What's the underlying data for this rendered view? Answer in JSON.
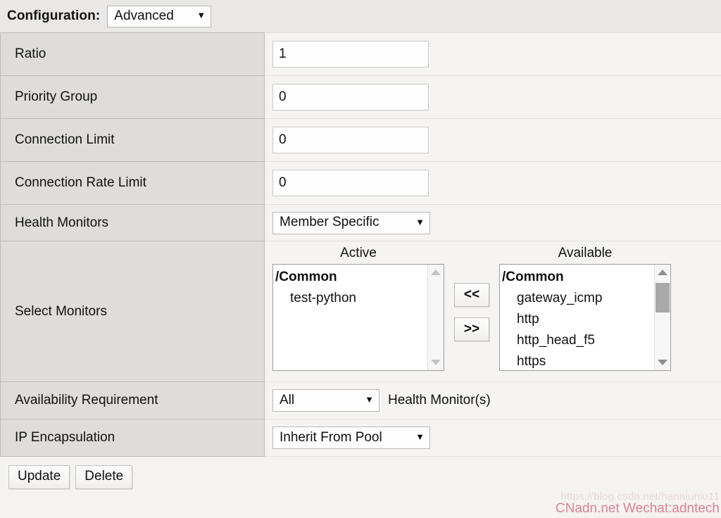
{
  "header": {
    "label": "Configuration:",
    "config_value": "Advanced",
    "caret": "▼"
  },
  "rows": [
    {
      "label": "Ratio",
      "value": "1"
    },
    {
      "label": "Priority Group",
      "value": "0"
    },
    {
      "label": "Connection Limit",
      "value": "0"
    },
    {
      "label": "Connection Rate Limit",
      "value": "0"
    },
    {
      "label": "Health Monitors",
      "value": "Member Specific"
    },
    {
      "label": "Select Monitors",
      "value": ""
    },
    {
      "label": "Availability Requirement",
      "value": "All",
      "suffix": "Health Monitor(s)"
    },
    {
      "label": "IP Encapsulation",
      "value": "Inherit From Pool"
    }
  ],
  "select_monitors": {
    "active": {
      "caption": "Active",
      "items": [
        {
          "text": "/Common",
          "type": "group"
        },
        {
          "text": "test-python",
          "type": "child"
        }
      ]
    },
    "available": {
      "caption": "Available",
      "items": [
        {
          "text": "/Common",
          "type": "group"
        },
        {
          "text": "gateway_icmp",
          "type": "child"
        },
        {
          "text": "http",
          "type": "child"
        },
        {
          "text": "http_head_f5",
          "type": "child"
        },
        {
          "text": "https",
          "type": "child"
        }
      ]
    },
    "move_left_label": "<<",
    "move_right_label": ">>"
  },
  "footer": {
    "update_label": "Update",
    "delete_label": "Delete"
  },
  "watermark": {
    "url": "https://blog.csdn.net/hanniuniu11",
    "text": "CNadn.net Wechat:adntech"
  },
  "colors": {
    "label_cell_bg": "#dedddb",
    "value_cell_bg": "#f5f4f2",
    "page_bg": "#f4f3f1",
    "header_bg": "#e9e8e6",
    "scroll_thumb": "#a9a9a9",
    "watermark_accent": "#dd8391"
  }
}
